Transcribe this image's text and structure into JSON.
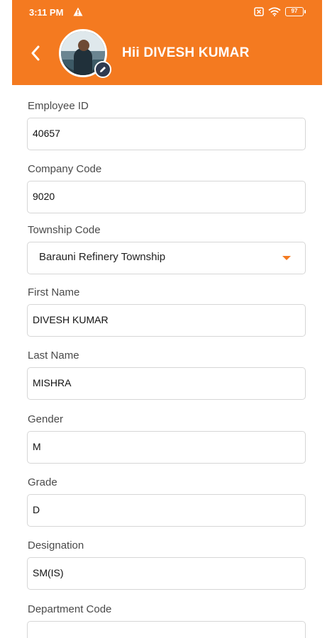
{
  "status_bar": {
    "time": "3:11 PM",
    "battery": "97"
  },
  "header": {
    "greeting": "Hii DIVESH KUMAR",
    "accent_color": "#F47A20"
  },
  "fields": {
    "employee_id": {
      "label": "Employee ID",
      "value": "40657"
    },
    "company_code": {
      "label": "Company Code",
      "value": "9020"
    },
    "township_code": {
      "label": "Township Code",
      "value": "Barauni Refinery Township"
    },
    "first_name": {
      "label": "First Name",
      "value": "DIVESH KUMAR"
    },
    "last_name": {
      "label": "Last Name",
      "value": "MISHRA"
    },
    "gender": {
      "label": "Gender",
      "value": "M"
    },
    "grade": {
      "label": "Grade",
      "value": "D"
    },
    "designation": {
      "label": "Designation",
      "value": "SM(IS)"
    },
    "department_code": {
      "label": "Department Code",
      "value": ""
    }
  }
}
